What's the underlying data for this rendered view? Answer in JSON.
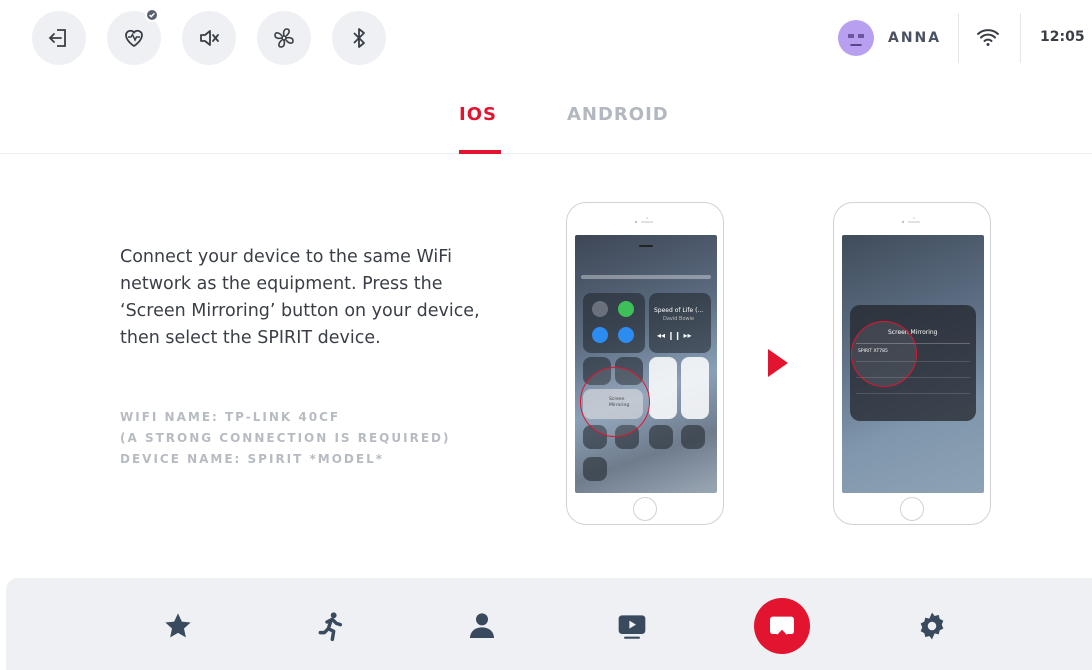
{
  "topbar": {
    "buttons": [
      "exit-icon",
      "heart-rate-icon",
      "mute-icon",
      "fan-icon",
      "bluetooth-icon"
    ],
    "user": {
      "name": "ANNA"
    },
    "time": "12:05"
  },
  "tabs": [
    {
      "label": "IOS",
      "active": true
    },
    {
      "label": "ANDROID",
      "active": false
    }
  ],
  "content": {
    "instructions": "Connect your device to the same WiFi network as the equipment. Press the ‘Screen Mirroring’ button on your device, then select the SPIRIT device.",
    "wifi_name": "WIFI NAME: TP-LINK 40CF",
    "connection_note": "(A STRONG CONNECTION IS REQUIRED)",
    "device_name": "DEVICE NAME: SPIRIT *MODEL*",
    "phone1": {
      "now_playing_title": "Speed of Life (...",
      "now_playing_artist": "David Bowie",
      "mirroring_label": "Screen Mirroring"
    },
    "phone2": {
      "mirroring_title": "Screen Mirroring",
      "device_option": "SPIRIT XT785"
    }
  },
  "bottom_nav": {
    "items": [
      "star-icon",
      "running-icon",
      "user-icon",
      "video-icon",
      "screen-mirror-icon",
      "gear-icon"
    ],
    "active_index": 4
  },
  "colors": {
    "accent": "#e3142f",
    "nav_bg": "#eef0f3",
    "inactive_tab": "#b3b8c0"
  }
}
